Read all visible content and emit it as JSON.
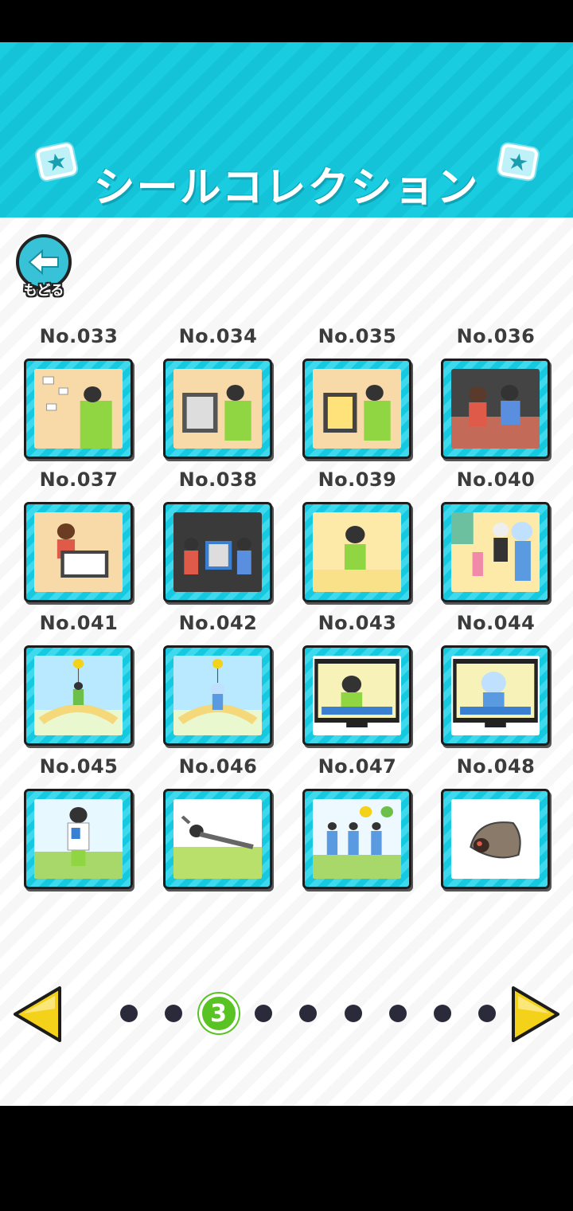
{
  "header": {
    "title": "シールコレクション",
    "accent_color": "#19cce0"
  },
  "back_button": {
    "label": "もどる",
    "icon": "left-arrow-icon"
  },
  "stickers": [
    {
      "label": "No.033",
      "scene": "office-papers"
    },
    {
      "label": "No.034",
      "scene": "tablet-portrait"
    },
    {
      "label": "No.035",
      "scene": "tablet-drawing"
    },
    {
      "label": "No.036",
      "scene": "friends-seated"
    },
    {
      "label": "No.037",
      "scene": "laptop-boy"
    },
    {
      "label": "No.038",
      "scene": "crowd-tablet"
    },
    {
      "label": "No.039",
      "scene": "boy-eating"
    },
    {
      "label": "No.040",
      "scene": "mascot-family"
    },
    {
      "label": "No.041",
      "scene": "balloon-park-boy"
    },
    {
      "label": "No.042",
      "scene": "balloon-park-mascot"
    },
    {
      "label": "No.043",
      "scene": "tv-boy"
    },
    {
      "label": "No.044",
      "scene": "tv-mascot"
    },
    {
      "label": "No.045",
      "scene": "boy-phone"
    },
    {
      "label": "No.046",
      "scene": "boy-fallen"
    },
    {
      "label": "No.047",
      "scene": "dancers-balloons"
    },
    {
      "label": "No.048",
      "scene": "hermit-shell"
    }
  ],
  "pagination": {
    "current": "3",
    "total_pages": 9,
    "active_color": "#58c322",
    "prev_icon": "left-triangle-icon",
    "next_icon": "right-triangle-icon"
  }
}
